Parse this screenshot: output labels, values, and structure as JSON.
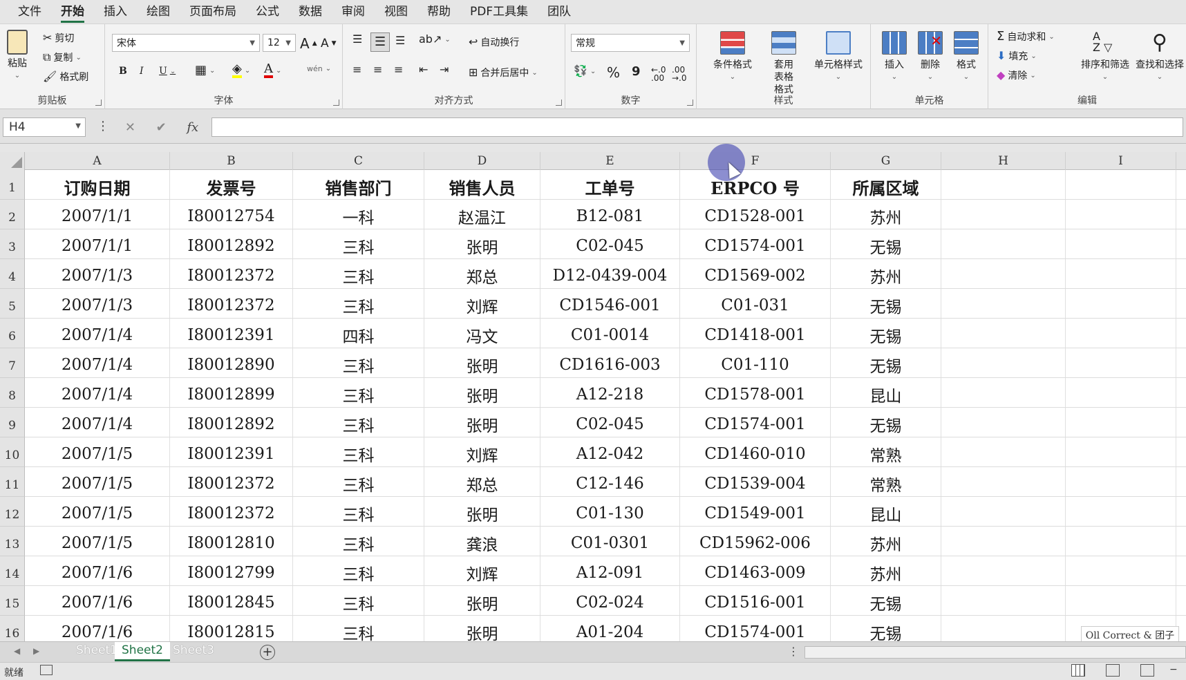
{
  "menu": [
    "文件",
    "开始",
    "插入",
    "绘图",
    "页面布局",
    "公式",
    "数据",
    "审阅",
    "视图",
    "帮助",
    "PDF工具集",
    "团队"
  ],
  "menu_active": 1,
  "ribbon": {
    "clipboard": {
      "label": "剪贴板",
      "paste": "粘贴",
      "cut": "剪切",
      "copy": "复制",
      "format_painter": "格式刷"
    },
    "font": {
      "label": "字体",
      "name": "宋体",
      "size": "12",
      "bold": "B",
      "italic": "I",
      "underline": "U",
      "grow": "A",
      "shrink": "A",
      "phonetic": "wén"
    },
    "alignment": {
      "label": "对齐方式",
      "wrap": "自动换行",
      "merge": "合并后居中"
    },
    "number": {
      "label": "数字",
      "format": "常规",
      "percent": "%",
      "comma": "9"
    },
    "styles": {
      "label": "样式",
      "conditional": "条件格式",
      "table_format": "套用表格格式",
      "cell_styles": "单元格样式"
    },
    "cells": {
      "label": "单元格",
      "insert": "插入",
      "delete": "删除",
      "format": "格式"
    },
    "editing": {
      "label": "编辑",
      "autosum": "自动求和",
      "fill": "填充",
      "clear": "清除",
      "sort": "排序和筛选",
      "find": "查找和选择"
    }
  },
  "formula_bar": {
    "name_box": "H4",
    "fx": "fx",
    "cancel": "✕",
    "enter": "✔"
  },
  "columns": [
    "A",
    "B",
    "C",
    "D",
    "E",
    "F",
    "G",
    "H",
    "I"
  ],
  "headers": [
    "订购日期",
    "发票号",
    "销售部门",
    "销售人员",
    "工单号",
    "ERPCO 号",
    "所属区域"
  ],
  "rows": [
    [
      "2007/1/1",
      "I80012754",
      "一科",
      "赵温江",
      "B12-081",
      "CD1528-001",
      "苏州"
    ],
    [
      "2007/1/1",
      "I80012892",
      "三科",
      "张明",
      "C02-045",
      "CD1574-001",
      "无锡"
    ],
    [
      "2007/1/3",
      "I80012372",
      "三科",
      "郑总",
      "D12-0439-004",
      "CD1569-002",
      "苏州"
    ],
    [
      "2007/1/3",
      "I80012372",
      "三科",
      "刘辉",
      "CD1546-001",
      "C01-031",
      "无锡"
    ],
    [
      "2007/1/4",
      "I80012391",
      "四科",
      "冯文",
      "C01-0014",
      "CD1418-001",
      "无锡"
    ],
    [
      "2007/1/4",
      "I80012890",
      "三科",
      "张明",
      "CD1616-003",
      "C01-110",
      "无锡"
    ],
    [
      "2007/1/4",
      "I80012899",
      "三科",
      "张明",
      "A12-218",
      "CD1578-001",
      "昆山"
    ],
    [
      "2007/1/4",
      "I80012892",
      "三科",
      "张明",
      "C02-045",
      "CD1574-001",
      "无锡"
    ],
    [
      "2007/1/5",
      "I80012391",
      "三科",
      "刘辉",
      "A12-042",
      "CD1460-010",
      "常熟"
    ],
    [
      "2007/1/5",
      "I80012372",
      "三科",
      "郑总",
      "C12-146",
      "CD1539-004",
      "常熟"
    ],
    [
      "2007/1/5",
      "I80012372",
      "三科",
      "张明",
      "C01-130",
      "CD1549-001",
      "昆山"
    ],
    [
      "2007/1/5",
      "I80012810",
      "三科",
      "龚浪",
      "C01-0301",
      "CD15962-006",
      "苏州"
    ],
    [
      "2007/1/6",
      "I80012799",
      "三科",
      "刘辉",
      "A12-091",
      "CD1463-009",
      "苏州"
    ],
    [
      "2007/1/6",
      "I80012845",
      "三科",
      "张明",
      "C02-024",
      "CD1516-001",
      "无锡"
    ],
    [
      "2007/1/6",
      "I80012815",
      "三科",
      "张明",
      "A01-204",
      "CD1574-001",
      "无锡"
    ]
  ],
  "sheets": [
    "Sheet1",
    "Sheet2",
    "Sheet3"
  ],
  "active_sheet": 1,
  "status": {
    "ready": "就绪"
  },
  "watermark": "Oll Correct & 团子",
  "colors": {
    "accent": "#217346",
    "cursor_highlight": "#2d32aa"
  }
}
